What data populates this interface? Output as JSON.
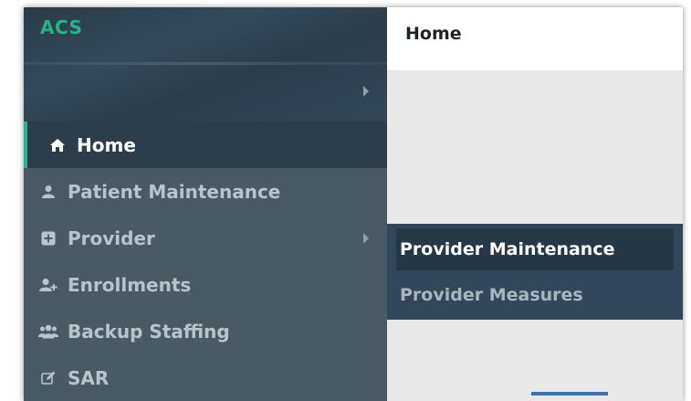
{
  "app": {
    "brand": "ACS"
  },
  "header": {
    "title": "Home"
  },
  "sidebar": {
    "items": [
      {
        "label": "Home",
        "icon": "home-icon",
        "active": true
      },
      {
        "label": "Patient Maintenance",
        "icon": "user-icon"
      },
      {
        "label": "Provider",
        "icon": "plus-square-icon",
        "has_submenu": true
      },
      {
        "label": "Enrollments",
        "icon": "user-plus-icon"
      },
      {
        "label": "Backup Staffing",
        "icon": "users-icon"
      },
      {
        "label": "SAR",
        "icon": "edit-icon"
      }
    ]
  },
  "flyout": {
    "items": [
      {
        "label": "Provider Maintenance",
        "selected": true
      },
      {
        "label": "Provider Measures"
      }
    ]
  },
  "colors": {
    "brand": "#26b38a",
    "sidebar_bg": "#4a5a64",
    "sidebar_active_bg": "#2c3e4c",
    "flyout_bg": "#33475a"
  }
}
